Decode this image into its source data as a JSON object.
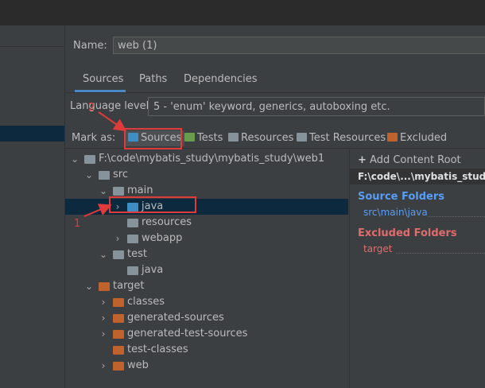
{
  "module": {
    "name_label": "Name:",
    "name_value": "web (1)"
  },
  "tabs": [
    {
      "label": "Sources",
      "active": true
    },
    {
      "label": "Paths",
      "active": false
    },
    {
      "label": "Dependencies",
      "active": false
    }
  ],
  "language_level": {
    "label": "Language level:",
    "value": "5 - 'enum' keyword, generics, autoboxing etc."
  },
  "mark_as": {
    "label": "Mark as:",
    "buttons": [
      {
        "label": "Sources",
        "icon": "folder-sources-icon",
        "color": "#3d8ec4"
      },
      {
        "label": "Tests",
        "icon": "folder-tests-icon",
        "color": "#6a9c4d"
      },
      {
        "label": "Resources",
        "icon": "folder-resources-icon",
        "color": "#87939a"
      },
      {
        "label": "Test Resources",
        "icon": "folder-test-resources-icon",
        "color": "#87939a"
      },
      {
        "label": "Excluded",
        "icon": "folder-excluded-icon",
        "color": "#c0622b"
      }
    ]
  },
  "tree": [
    {
      "label": "F:\\code\\mybatis_study\\mybatis_study\\web1",
      "chevron": "down",
      "folder": "grey"
    },
    {
      "label": "src",
      "chevron": "down",
      "folder": "grey"
    },
    {
      "label": "main",
      "chevron": "down",
      "folder": "grey"
    },
    {
      "label": "java",
      "chevron": "right",
      "folder": "blue"
    },
    {
      "label": "resources",
      "chevron": "",
      "folder": "grey"
    },
    {
      "label": "webapp",
      "chevron": "right",
      "folder": "grey"
    },
    {
      "label": "test",
      "chevron": "down",
      "folder": "grey"
    },
    {
      "label": "java",
      "chevron": "",
      "folder": "grey"
    },
    {
      "label": "target",
      "chevron": "down",
      "folder": "orange"
    },
    {
      "label": "classes",
      "chevron": "right",
      "folder": "orange"
    },
    {
      "label": "generated-sources",
      "chevron": "right",
      "folder": "orange"
    },
    {
      "label": "generated-test-sources",
      "chevron": "right",
      "folder": "orange"
    },
    {
      "label": "test-classes",
      "chevron": "",
      "folder": "orange"
    },
    {
      "label": "web",
      "chevron": "right",
      "folder": "orange"
    }
  ],
  "content_root": {
    "add_label": "Add Content Root",
    "path": "F:\\code\\...\\mybatis_study\\",
    "source_folders_title": "Source Folders",
    "source_folder": "src\\main\\java",
    "excluded_folders_title": "Excluded Folders",
    "excluded_folder": "target"
  },
  "annotations": {
    "marker_1": "1",
    "marker_2": "2"
  },
  "colors": {
    "accent": "#4a88c7",
    "annotation": "#e03b3b",
    "selection": "#0d293e"
  }
}
